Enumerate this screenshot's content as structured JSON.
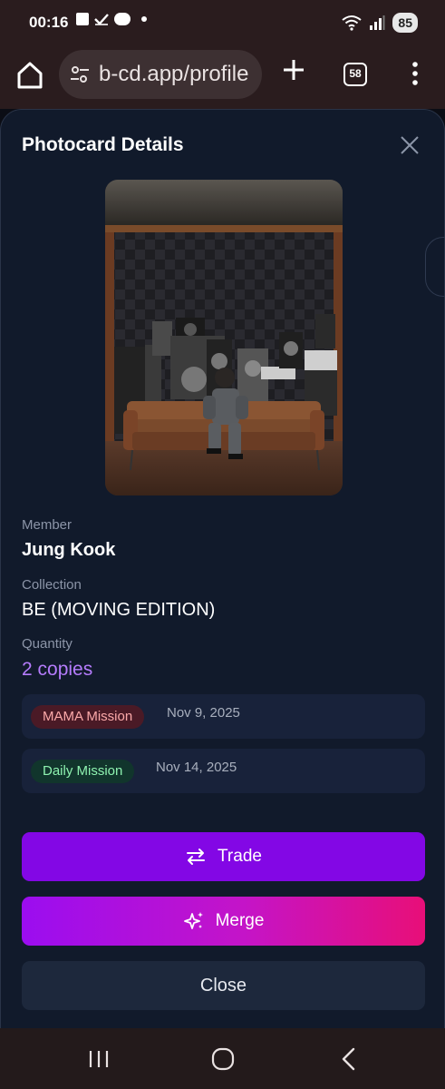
{
  "status_bar": {
    "time": "00:16",
    "battery": "85"
  },
  "browser": {
    "url": "b-cd.app/profile",
    "tab_count": "58"
  },
  "modal": {
    "title": "Photocard Details",
    "member_label": "Member",
    "member_value": "Jung Kook",
    "collection_label": "Collection",
    "collection_value": "BE (MOVING EDITION)",
    "quantity_label": "Quantity",
    "quantity_value": "2 copies",
    "missions": [
      {
        "badge": "MAMA Mission",
        "date": "Nov 9, 2025",
        "color": "#fba9a9"
      },
      {
        "badge": "Daily Mission",
        "date": "Nov 14, 2025",
        "color": "#8ef2b0"
      }
    ],
    "trade_label": "Trade",
    "merge_label": "Merge",
    "close_label": "Close"
  },
  "colors": {
    "accent_purple": "#8307e5",
    "quantity_purple": "#b57cfc",
    "merge_gradient_end": "#e80f78"
  },
  "icons": {
    "status": [
      "package-icon",
      "checkmark-icon",
      "webtoon-icon",
      "notification-dot-icon",
      "wifi-icon",
      "signal-icon"
    ],
    "browser": [
      "home-icon",
      "site-settings-icon",
      "plus-icon",
      "tab-switcher-icon",
      "more-vert-icon"
    ],
    "modal": [
      "close-icon",
      "swap-arrows-icon",
      "sparkles-icon"
    ],
    "nav": [
      "recents-icon",
      "home-circle-icon",
      "back-chevron-icon"
    ]
  }
}
